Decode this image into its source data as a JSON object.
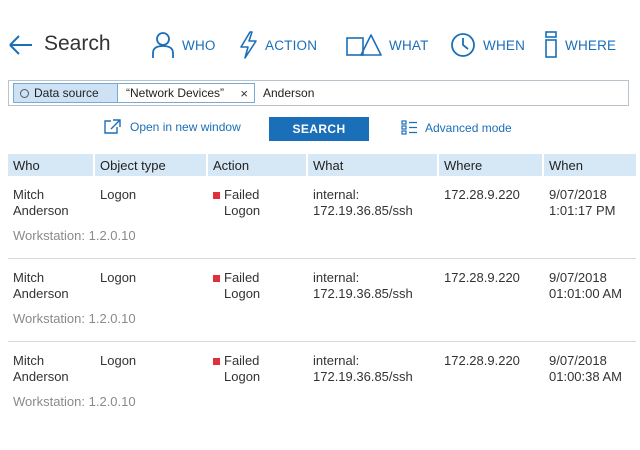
{
  "header": {
    "title": "Search",
    "nav": [
      {
        "label": "WHO",
        "icon": "person-icon"
      },
      {
        "label": "ACTION",
        "icon": "lightning-icon"
      },
      {
        "label": "WHAT",
        "icon": "shapes-icon"
      },
      {
        "label": "WHEN",
        "icon": "clock-icon"
      },
      {
        "label": "WHERE",
        "icon": "server-icon"
      }
    ]
  },
  "search": {
    "filter_key": "Data source",
    "filter_value": "“Network Devices”",
    "remove_symbol": "×",
    "query": "Anderson"
  },
  "actions": {
    "open_new_window": "Open in new window",
    "search_button": "SEARCH",
    "advanced_mode": "Advanced mode"
  },
  "table": {
    "columns": [
      "Who",
      "Object type",
      "Action",
      "What",
      "Where",
      "When"
    ],
    "rows": [
      {
        "who": [
          "Mitch",
          "Anderson"
        ],
        "object_type": "Logon",
        "action": [
          "Failed",
          "Logon"
        ],
        "what": [
          "internal:",
          "172.19.36.85/ssh"
        ],
        "where": "172.28.9.220",
        "when": [
          "9/07/2018",
          "1:01:17 PM"
        ],
        "workstation": "Workstation: 1.2.0.10"
      },
      {
        "who": [
          "Mitch",
          "Anderson"
        ],
        "object_type": "Logon",
        "action": [
          "Failed",
          "Logon"
        ],
        "what": [
          "internal:",
          "172.19.36.85/ssh"
        ],
        "where": "172.28.9.220",
        "when": [
          "9/07/2018",
          "01:01:00 AM"
        ],
        "workstation": "Workstation: 1.2.0.10"
      },
      {
        "who": [
          "Mitch",
          "Anderson"
        ],
        "object_type": "Logon",
        "action": [
          "Failed",
          "Logon"
        ],
        "what": [
          "internal:",
          "172.19.36.85/ssh"
        ],
        "where": "172.28.9.220",
        "when": [
          "9/07/2018",
          "01:00:38 AM"
        ],
        "workstation": "Workstation: 1.2.0.10"
      }
    ]
  },
  "colors": {
    "accent": "#1b6fb8",
    "header_bg": "#d6e8f6",
    "chip_bg": "#cde3f5",
    "failed_marker": "#e0303a"
  }
}
